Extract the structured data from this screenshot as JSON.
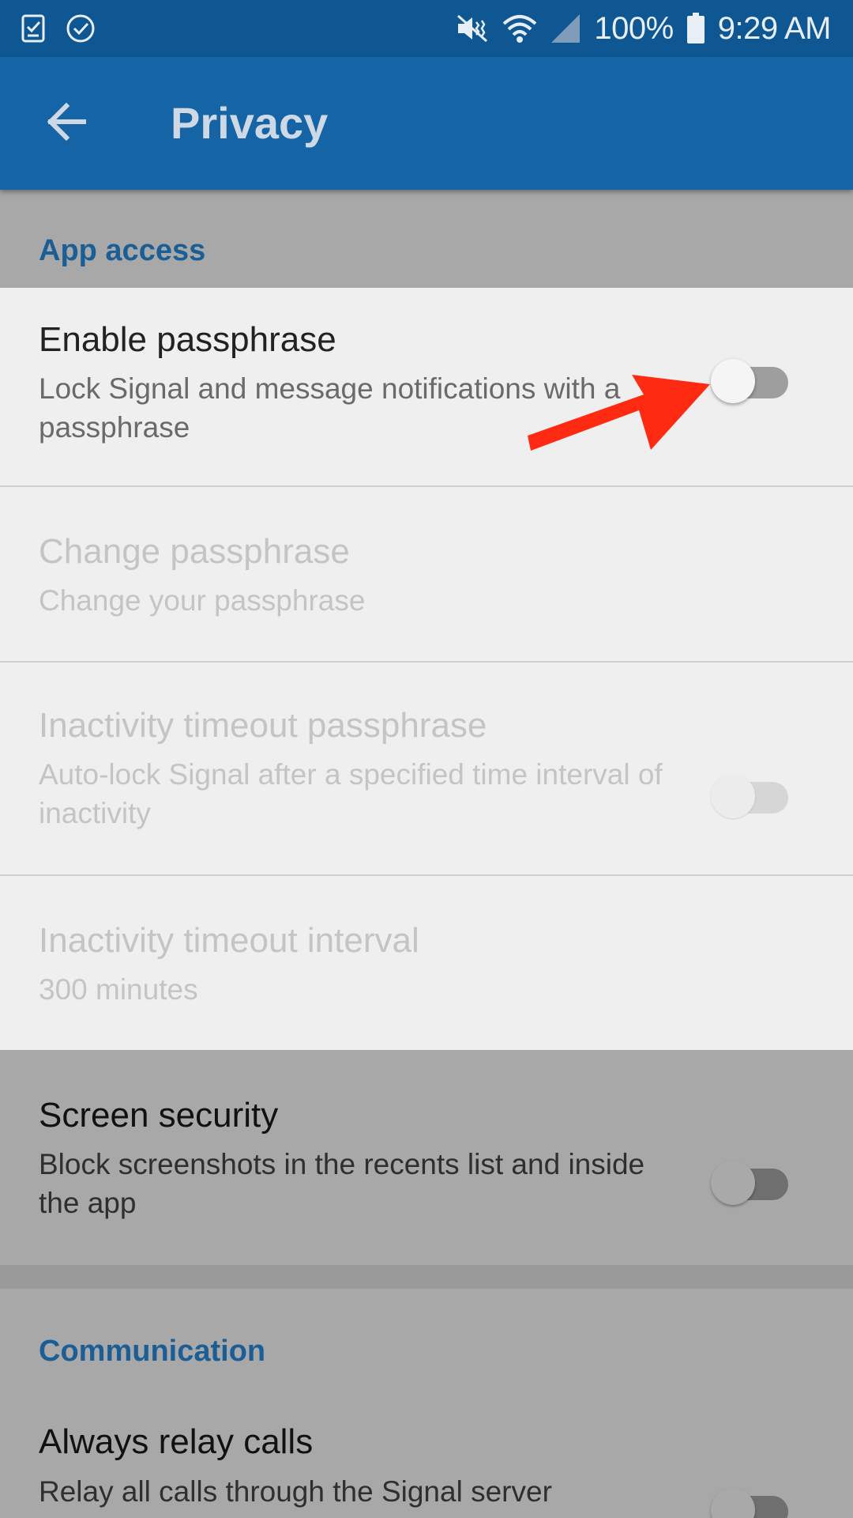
{
  "status_bar": {
    "left_icons": [
      "task-check-icon",
      "check-circle-icon"
    ],
    "right_icons": [
      "vibrate-mute-icon",
      "wifi-icon",
      "cellular-signal-icon",
      "battery-icon"
    ],
    "battery": "100%",
    "time": "9:29 AM"
  },
  "app_bar": {
    "back_icon": "back-arrow-icon",
    "title": "Privacy"
  },
  "sections": {
    "app_access": "App access",
    "communication": "Communication"
  },
  "prefs": {
    "enable_passphrase": {
      "title": "Enable passphrase",
      "summary": "Lock Signal and message notifications with a passphrase",
      "checked": false
    },
    "change_passphrase": {
      "title": "Change passphrase",
      "summary": "Change your passphrase",
      "enabled": false
    },
    "inactivity_timeout_passphrase": {
      "title": "Inactivity timeout passphrase",
      "summary": "Auto-lock Signal after a specified time interval of inactivity",
      "checked": false,
      "enabled": false
    },
    "inactivity_timeout_interval": {
      "title": "Inactivity timeout interval",
      "summary": "300 minutes",
      "enabled": false
    },
    "screen_security": {
      "title": "Screen security",
      "summary": "Block screenshots in the recents list and inside the app",
      "checked": false
    },
    "always_relay_calls": {
      "title": "Always relay calls",
      "summary": "Relay all calls through the Signal server",
      "checked": false
    }
  },
  "colors": {
    "status_bar": "#0f5793",
    "app_bar": "#1565a6",
    "accent": "#1b5e96",
    "annotation_arrow": "#ff2a12"
  }
}
